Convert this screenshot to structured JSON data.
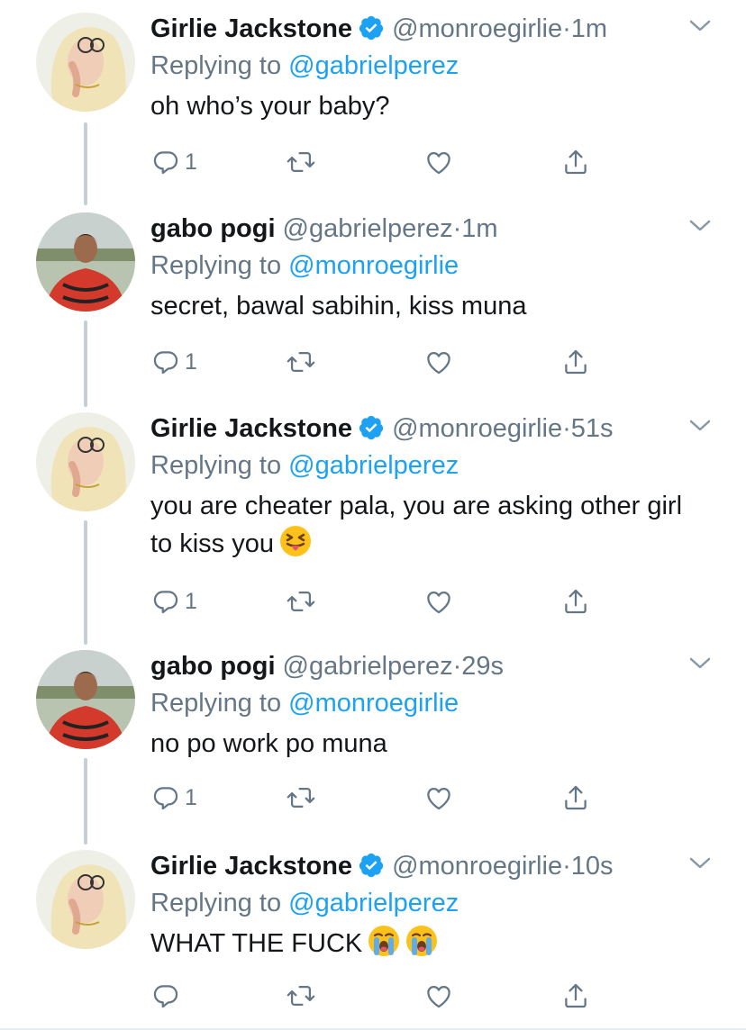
{
  "tweets": [
    {
      "name": "Girlie Jackstone",
      "verified": true,
      "handle": "@monroegirlie",
      "dot": "·",
      "time": "1m",
      "reply_prefix": "Replying to ",
      "reply_to": "@gabrielperez",
      "text": "oh who’s your baby?",
      "reply_count": "1",
      "emoji": []
    },
    {
      "name": "gabo pogi",
      "verified": false,
      "handle": "@gabrielperez",
      "dot": "·",
      "time": "1m",
      "reply_prefix": "Replying to ",
      "reply_to": "@monroegirlie",
      "text": "secret, bawal sabihin, kiss muna",
      "reply_count": "1",
      "emoji": []
    },
    {
      "name": "Girlie Jackstone",
      "verified": true,
      "handle": "@monroegirlie",
      "dot": "·",
      "time": "51s",
      "reply_prefix": "Replying to ",
      "reply_to": "@gabrielperez",
      "text": "you are cheater pala, you are asking other girl to kiss you",
      "reply_count": "1",
      "emoji": [
        "squinting-face-with-tongue-emoji"
      ]
    },
    {
      "name": "gabo pogi",
      "verified": false,
      "handle": "@gabrielperez",
      "dot": "·",
      "time": "29s",
      "reply_prefix": "Replying to ",
      "reply_to": "@monroegirlie",
      "text": "no po work po muna",
      "reply_count": "1",
      "emoji": []
    },
    {
      "name": "Girlie Jackstone",
      "verified": true,
      "handle": "@monroegirlie",
      "dot": "·",
      "time": "10s",
      "reply_prefix": "Replying to ",
      "reply_to": "@gabrielperez",
      "text": "WHAT THE FUCK",
      "reply_count": "",
      "emoji": [
        "loudly-crying-face-emoji",
        "loudly-crying-face-emoji"
      ]
    }
  ],
  "colors": {
    "link": "#1da1f2",
    "secondary_text": "#657786",
    "primary_text": "#14171a",
    "thread_line": "#c4cfd6"
  },
  "icons": [
    "verified-badge-icon",
    "chevron-down-icon",
    "reply-icon",
    "retweet-icon",
    "like-icon",
    "share-icon"
  ]
}
